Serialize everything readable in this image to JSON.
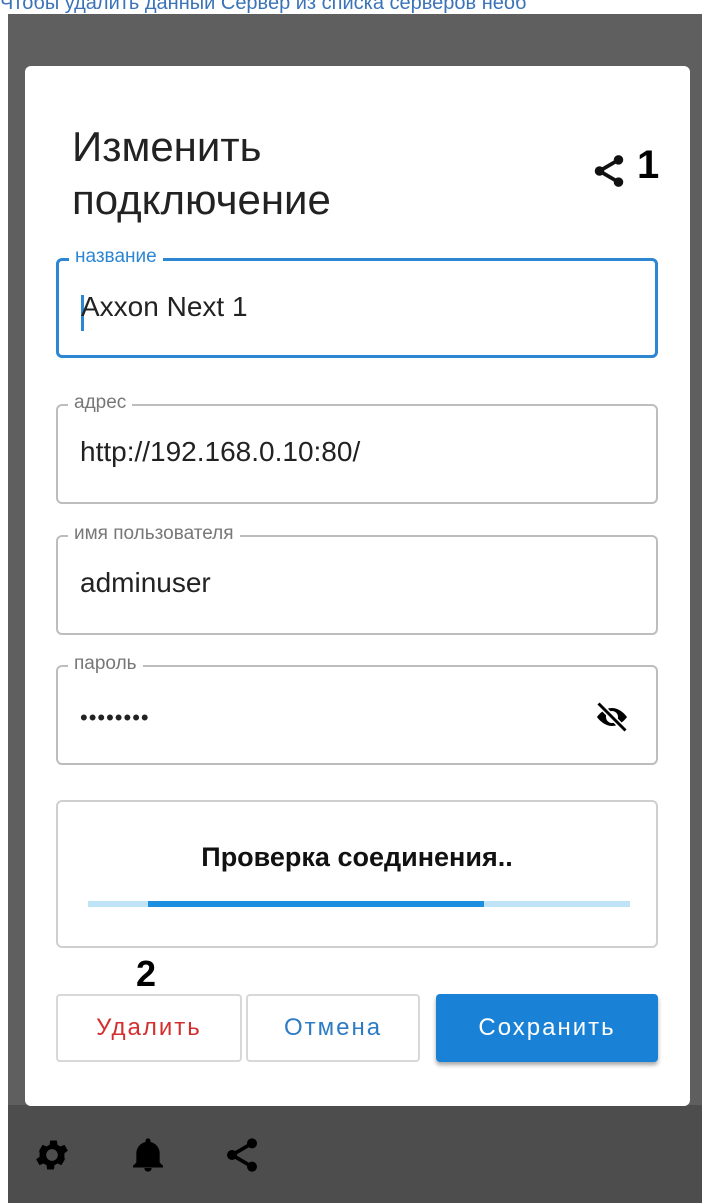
{
  "doc_caption": "Чтобы удалить данный Сервер из списка серверов необ",
  "dialog": {
    "title": "Изменить подключение",
    "share_icon": "share-icon",
    "annotation_1": "1",
    "annotation_2": "2"
  },
  "fields": {
    "name": {
      "label": "название",
      "value": "Axxon Next 1"
    },
    "address": {
      "label": "адрес",
      "value": "http://192.168.0.10:80/"
    },
    "username": {
      "label": "имя пользователя",
      "value": "adminuser"
    },
    "password": {
      "label": "пароль",
      "value": "••••••••",
      "toggle_icon": "eye-off-icon"
    }
  },
  "connection_check": {
    "text": "Проверка соединения..",
    "progress_start": 0.11,
    "progress_end": 0.73
  },
  "buttons": {
    "delete": "Удалить",
    "cancel": "Отмена",
    "save": "Сохранить"
  },
  "bottom_bar": {
    "icons": [
      "gear-icon",
      "bell-icon",
      "share-icon"
    ]
  },
  "colors": {
    "accent": "#1a82d6",
    "focus": "#2d86d2",
    "danger": "#d32f2f",
    "scrim": "#5f5f5f"
  }
}
